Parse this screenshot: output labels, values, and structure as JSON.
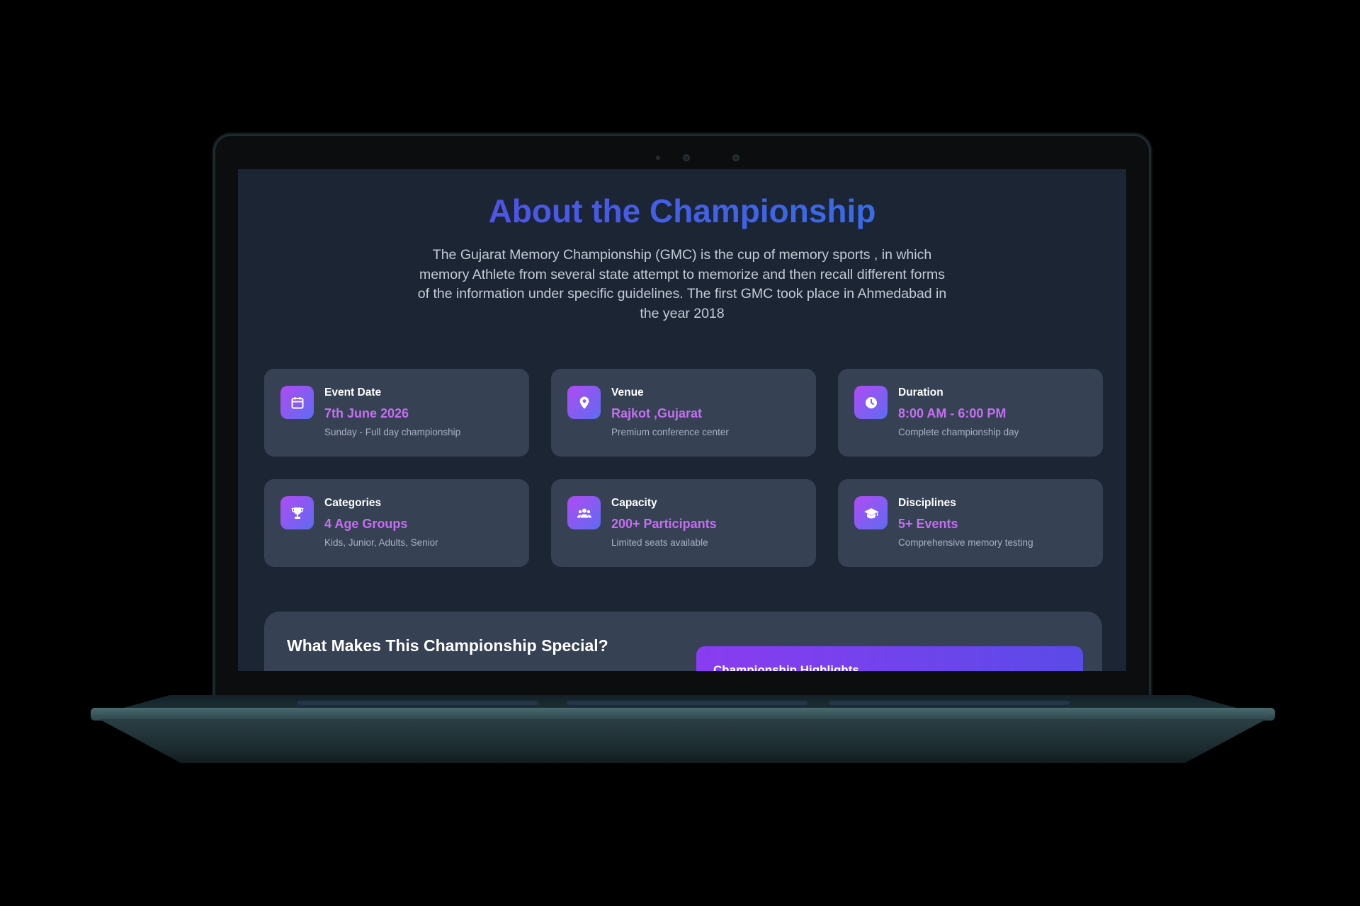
{
  "section": {
    "title": "About the Championship",
    "intro": "The Gujarat Memory Championship (GMC) is the cup of memory sports , in which memory Athlete from several state attempt to memorize and then recall different forms of the information under specific guidelines. The first GMC took place in Ahmedabad in the year 2018"
  },
  "cards": [
    {
      "icon": "calendar-icon",
      "label": "Event Date",
      "value": "7th June 2026",
      "sub": "Sunday - Full day championship"
    },
    {
      "icon": "location-pin-icon",
      "label": "Venue",
      "value": "Rajkot ,Gujarat",
      "sub": "Premium conference center"
    },
    {
      "icon": "clock-icon",
      "label": "Duration",
      "value": "8:00 AM - 6:00 PM",
      "sub": "Complete championship day"
    },
    {
      "icon": "trophy-icon",
      "label": "Categories",
      "value": "4 Age Groups",
      "sub": "Kids, Junior, Adults, Senior"
    },
    {
      "icon": "users-icon",
      "label": "Capacity",
      "value": "200+ Participants",
      "sub": "Limited seats available"
    },
    {
      "icon": "graduation-cap-icon",
      "label": "Disciplines",
      "value": "5+ Events",
      "sub": "Comprehensive memory testing"
    }
  ],
  "special": {
    "title": "What Makes This Championship Special?",
    "highlights_title": "Championship Highlights"
  },
  "colors": {
    "page_background": "#1c2534",
    "card_background": "#364154",
    "accent_value": "#c46ff0",
    "title_gradient_start": "#5b45e6",
    "title_gradient_end": "#2a7ae8",
    "icon_gradient_start": "#b04bf3",
    "icon_gradient_end": "#5d6cf1"
  }
}
